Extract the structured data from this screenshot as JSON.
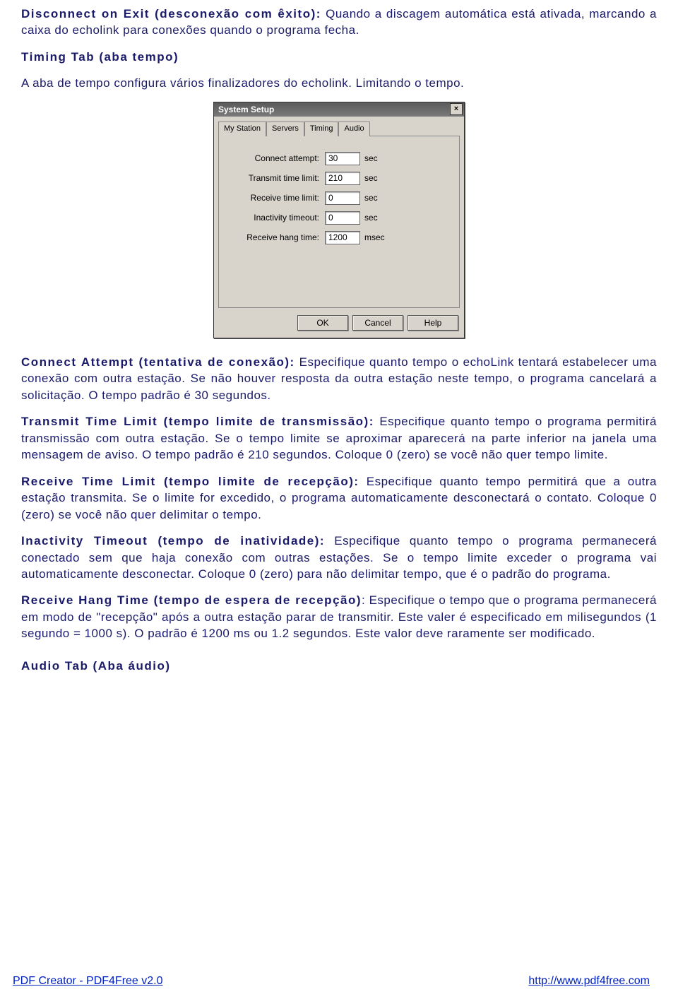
{
  "p1_bold": "Disconnect on Exit (desconexão com êxito):",
  "p1_rest": "  Quando a discagem automática está ativada, marcando  a caixa  do echolink para conexões quando o programa fecha.",
  "p2_bold": "Timing Tab (aba tempo)",
  "p3": "A aba de tempo configura vários finalizadores do echolink. Limitando o tempo.",
  "dlg": {
    "title": "System Setup",
    "tabs": [
      "My Station",
      "Servers",
      "Timing",
      "Audio"
    ],
    "active_tab": 2,
    "rows": [
      {
        "label": "Connect attempt:",
        "value": "30",
        "unit": "sec"
      },
      {
        "label": "Transmit time limit:",
        "value": "210",
        "unit": "sec"
      },
      {
        "label": "Receive time limit:",
        "value": "0",
        "unit": "sec"
      },
      {
        "label": "Inactivity timeout:",
        "value": "0",
        "unit": "sec"
      },
      {
        "label": "Receive hang time:",
        "value": "1200",
        "unit": "msec"
      }
    ],
    "buttons": {
      "ok": "OK",
      "cancel": "Cancel",
      "help": "Help"
    },
    "close": "×"
  },
  "p4_bold": "Connect Attempt (tentativa de conexão):",
  "p4_rest": " Especifique quanto tempo o echoLink tentará estabelecer uma conexão com outra estação. Se não houver resposta da outra estação neste tempo, o programa cancelará a solicitação. O tempo padrão é 30 segundos.",
  "p5_bold": "Transmit Time Limit (tempo limite de transmissão):",
  "p5_rest": "  Especifique quanto tempo o programa permitirá transmissão com outra estação. Se o tempo limite se aproximar aparecerá na parte inferior na janela uma mensagem de aviso. O tempo padrão é 210 segundos. Coloque 0 (zero) se você não quer tempo limite.",
  "p6_bold": "Receive Time Limit (tempo limite de recepção):",
  "p6_rest": "  Especifique quanto tempo permitirá que a outra estação transmita. Se o limite for excedido, o programa automaticamente desconectará o contato. Coloque 0 (zero) se você não quer delimitar o tempo.",
  "p7_bold": "Inactivity Timeout (tempo de inatividade):",
  "p7_rest": " Especifique quanto tempo o programa permanecerá conectado sem que haja conexão com outras estações. Se o tempo limite exceder o programa vai automaticamente desconectar. Coloque 0 (zero) para não delimitar tempo, que é o padrão do programa.",
  "p8_bold": "Receive Hang Time (tempo de espera de recepção)",
  "p8_rest": ": Especifique o tempo que o programa permanecerá em modo de \"recepção\" após a outra estação parar de transmitir. Este valer é especificado em milisegundos (1 segundo = 1000 s). O padrão é 1200 ms ou 1.2 segundos. Este valor deve raramente ser modificado.",
  "p9_bold": "Audio Tab (Aba áudio)",
  "footer_left": "PDF Creator - PDF4Free v2.0",
  "footer_right": "http://www.pdf4free.com"
}
